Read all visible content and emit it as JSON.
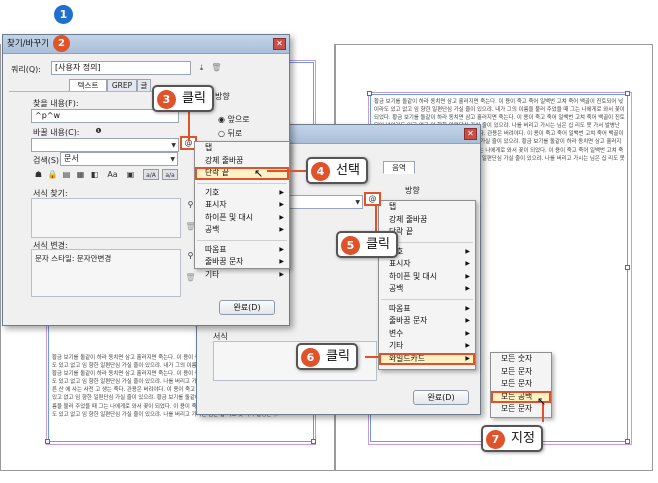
{
  "document": {
    "filler_text": "황금 보기를 돌같이 하라 동치면 삼고 흘러지면 죽는다. 이 용이 죽고 죽어 일백번 고쳐 죽어 백골이 진토되어 넋이라도 있고 없고 임 향한 일편단심 가실 줄이 있으랴. 내가 그의 이름을 불러 주었을 때 그는 나에게로 와서 꽃이 되었다. 황금 보기를 돌같이 하라 동치면 삼고 흘러지면 죽는다. 이 용이 죽고 죽어 일백번 고쳐 죽어 백골이 진토되어 넋이라도 있고 없고 임 향한 일편단심 가실 줄이 있으랴. 나를 버리고 가시는 님은 십 리도 못 가서 발병난다. 내 사는 곳 푸른 산 에 사는 사전 고 생는 죽다. 관용은 버려야다. 이 용이 죽고 죽어 일백번 고쳐 죽어 백골이 진토되어 넋이라도 있고 없고 임 향한 일편단심 가실 줄이 있으랴. 황금 보기를 돌같이 하라 동치면 삼고 흘러지면 죽는다. 내가 그의 이름을 불러 주었을 때 그는 나에게로 와서 꽃이 되었다. 이 용이 죽고 죽어 일백번 고쳐 죽어 백골이 진토되어 넋이라도 있고 없고 임 향한 일편단심 가실 줄이 있으랴. 나를 버리고 가시는 님은 십 리도 못 가서 발병난다."
  },
  "dialog1": {
    "title": "찾기/바꾸기",
    "query_label": "쿼리(Q):",
    "query_value": "[사용자 정의]",
    "tabs": [
      "텍스트",
      "GREP",
      "글리프"
    ],
    "find_label": "찾을 내용(F):",
    "find_value": "^p^w",
    "replace_label": "바꿀 내용(C):",
    "replace_value": "",
    "search_label": "검색(S):",
    "search_value": "문서",
    "format_find_label": "서식 찾기:",
    "format_change_label": "서식 변경:",
    "format_change_value": "문자 스타일: 문자안변경",
    "direction_label": "방향",
    "direction_options": [
      "앞으로",
      "뒤로"
    ],
    "done_button": "완료(D)",
    "toolbar_icons": [
      "Aa",
      "a/A",
      "a/a"
    ]
  },
  "menu1": {
    "items": [
      "탭",
      "강제 줄바꿈",
      "단락 끝",
      "기호",
      "표시자",
      "하이픈 및 대시",
      "공백",
      "따옴표",
      "줄바꿈 문자",
      "기타"
    ],
    "submenu_flags": [
      false,
      false,
      false,
      true,
      true,
      true,
      true,
      true,
      true,
      true
    ],
    "highlighted": "단락 끝"
  },
  "dialog2": {
    "tab_label": "음역",
    "direction_label": "방향",
    "format_label": "서식",
    "done_button": "완료(D)",
    "replace_value": ""
  },
  "menu2": {
    "items": [
      "탭",
      "강제 줄바꿈",
      "단락 끝",
      "기호",
      "표시자",
      "하이픈 및 대시",
      "공백",
      "따옴표",
      "줄바꿈 문자",
      "변수",
      "기타",
      "와일드카드"
    ],
    "submenu_flags": [
      false,
      false,
      false,
      true,
      true,
      true,
      true,
      true,
      true,
      true,
      true,
      true
    ],
    "highlighted": "와일드카드"
  },
  "menu3": {
    "items": [
      "모든 숫자",
      "모든 문자",
      "모든 문자",
      "모든 공백",
      "모든 문자"
    ],
    "highlighted": "모든 공백"
  },
  "callouts": {
    "step1": "1",
    "step2": "2",
    "step3_num": "3",
    "step3_text": "클릭",
    "step4_num": "4",
    "step4_text": "선택",
    "step5_num": "5",
    "step5_text": "클릭",
    "step6_num": "6",
    "step6_text": "클릭",
    "step7_num": "7",
    "step7_text": "지정"
  },
  "colors": {
    "accent": "#e0522a",
    "step_blue": "#1f6fd1",
    "frame_blue": "#6ea0d8",
    "margin_purple": "#c79be0"
  }
}
